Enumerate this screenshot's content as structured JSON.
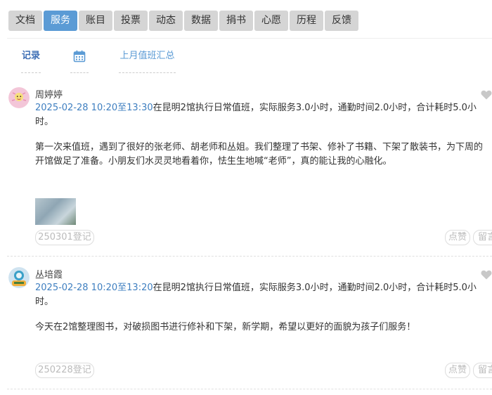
{
  "nav": {
    "tabs": [
      {
        "label": "文档",
        "active": false
      },
      {
        "label": "服务",
        "active": true
      },
      {
        "label": "账目",
        "active": false
      },
      {
        "label": "投票",
        "active": false
      },
      {
        "label": "动态",
        "active": false
      },
      {
        "label": "数据",
        "active": false
      },
      {
        "label": "捐书",
        "active": false
      },
      {
        "label": "心愿",
        "active": false
      },
      {
        "label": "历程",
        "active": false
      },
      {
        "label": "反馈",
        "active": false
      }
    ]
  },
  "subtabs": {
    "record": "记录",
    "calendar_icon": "calendar-icon",
    "summary": "上月值班汇总"
  },
  "posts": [
    {
      "author": "周婷婷",
      "time_range": "2025-02-28 10:20至13:30",
      "summary": "在昆明2馆执行日常值班，实际服务3.0小时，通勤时间2.0小时，合计耗时5.0小时。",
      "body": "第一次来值班，遇到了很好的张老师、胡老师和丛姐。我们整理了书架、修补了书籍、下架了散装书，为下周的开馆做足了准备。小朋友们水灵灵地看着你，怯生生地喊“老师”，真的能让我的心融化。",
      "register": "250301登记",
      "like": "点赞",
      "message": "留言"
    },
    {
      "author": "丛培霞",
      "time_range": "2025-02-28 10:20至13:20",
      "summary": "在昆明2馆执行日常值班，实际服务3.0小时，通勤时间2.0小时，合计耗时5.0小时。",
      "body": "今天在2馆整理图书，对破损图书进行修补和下架，新学期，希望以更好的面貌为孩子们服务！",
      "register": "250228登记",
      "like": "点赞",
      "message": "留言"
    }
  ],
  "colors": {
    "accent": "#5b9bd5",
    "tab_bg": "#d5d5d5",
    "time": "#3f7fc0"
  }
}
